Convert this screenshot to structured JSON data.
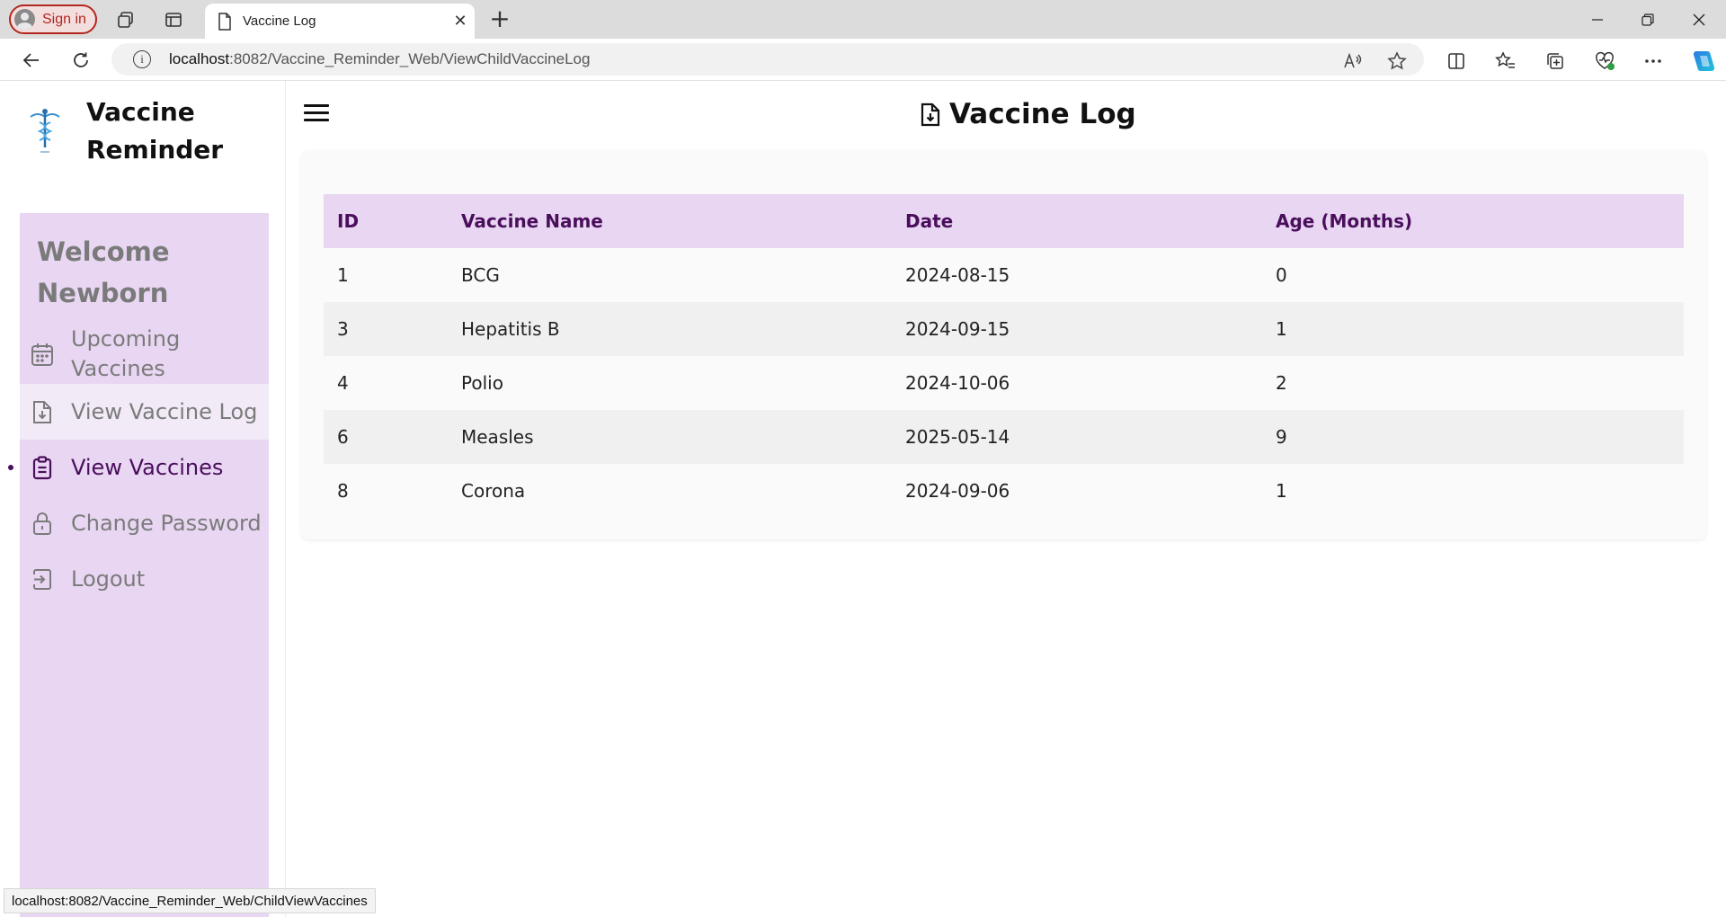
{
  "browser": {
    "signin_label": "Sign in",
    "tab_title": "Vaccine Log",
    "url_host": "localhost",
    "url_rest": ":8082/Vaccine_Reminder_Web/ViewChildVaccineLog",
    "status_url": "localhost:8082/Vaccine_Reminder_Web/ChildViewVaccines"
  },
  "sidebar": {
    "brand": "Vaccine Reminder",
    "welcome": "Welcome Newborn",
    "items": [
      {
        "label": "Upcoming Vaccines",
        "icon": "calendar-icon"
      },
      {
        "label": "View Vaccine Log",
        "icon": "file-download-icon"
      },
      {
        "label": "View Vaccines",
        "icon": "clipboard-icon"
      },
      {
        "label": "Change Password",
        "icon": "lock-icon"
      },
      {
        "label": "Logout",
        "icon": "logout-icon"
      }
    ]
  },
  "main": {
    "title": "Vaccine Log",
    "table": {
      "headers": [
        "ID",
        "Vaccine Name",
        "Date",
        "Age (Months)"
      ],
      "rows": [
        [
          "1",
          "BCG",
          "2024-08-15",
          "0"
        ],
        [
          "3",
          "Hepatitis B",
          "2024-09-15",
          "1"
        ],
        [
          "4",
          "Polio",
          "2024-10-06",
          "2"
        ],
        [
          "6",
          "Measles",
          "2025-05-14",
          "9"
        ],
        [
          "8",
          "Corona",
          "2024-09-06",
          "1"
        ]
      ]
    }
  },
  "colors": {
    "accent": "#4a0e5c",
    "sidebar_panel": "#e8d6f2",
    "table_header": "#e8d6f2"
  }
}
